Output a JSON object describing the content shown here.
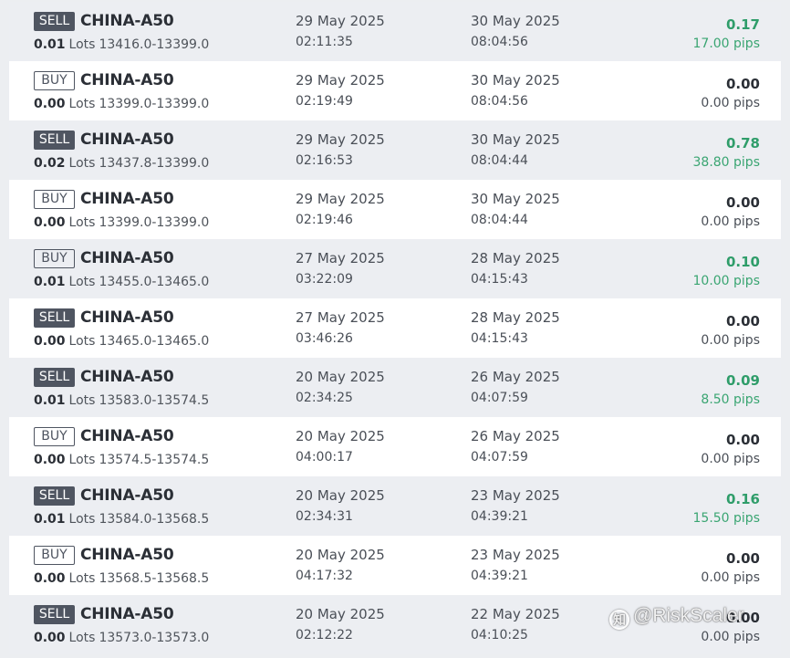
{
  "trades": [
    {
      "side": "SELL",
      "symbol": "CHINA-A50",
      "lots": "0.01",
      "lots_label": "Lots",
      "price_range": "13416.0-13399.0",
      "open_date": "29 May 2025",
      "open_time": "02:11:35",
      "close_date": "30 May 2025",
      "close_time": "08:04:56",
      "profit": "0.17",
      "pips": "17.00 pips"
    },
    {
      "side": "BUY",
      "symbol": "CHINA-A50",
      "lots": "0.00",
      "lots_label": "Lots",
      "price_range": "13399.0-13399.0",
      "open_date": "29 May 2025",
      "open_time": "02:19:49",
      "close_date": "30 May 2025",
      "close_time": "08:04:56",
      "profit": "0.00",
      "pips": "0.00 pips"
    },
    {
      "side": "SELL",
      "symbol": "CHINA-A50",
      "lots": "0.02",
      "lots_label": "Lots",
      "price_range": "13437.8-13399.0",
      "open_date": "29 May 2025",
      "open_time": "02:16:53",
      "close_date": "30 May 2025",
      "close_time": "08:04:44",
      "profit": "0.78",
      "pips": "38.80 pips"
    },
    {
      "side": "BUY",
      "symbol": "CHINA-A50",
      "lots": "0.00",
      "lots_label": "Lots",
      "price_range": "13399.0-13399.0",
      "open_date": "29 May 2025",
      "open_time": "02:19:46",
      "close_date": "30 May 2025",
      "close_time": "08:04:44",
      "profit": "0.00",
      "pips": "0.00 pips"
    },
    {
      "side": "BUY",
      "symbol": "CHINA-A50",
      "lots": "0.01",
      "lots_label": "Lots",
      "price_range": "13455.0-13465.0",
      "open_date": "27 May 2025",
      "open_time": "03:22:09",
      "close_date": "28 May 2025",
      "close_time": "04:15:43",
      "profit": "0.10",
      "pips": "10.00 pips"
    },
    {
      "side": "SELL",
      "symbol": "CHINA-A50",
      "lots": "0.00",
      "lots_label": "Lots",
      "price_range": "13465.0-13465.0",
      "open_date": "27 May 2025",
      "open_time": "03:46:26",
      "close_date": "28 May 2025",
      "close_time": "04:15:43",
      "profit": "0.00",
      "pips": "0.00 pips"
    },
    {
      "side": "SELL",
      "symbol": "CHINA-A50",
      "lots": "0.01",
      "lots_label": "Lots",
      "price_range": "13583.0-13574.5",
      "open_date": "20 May 2025",
      "open_time": "02:34:25",
      "close_date": "26 May 2025",
      "close_time": "04:07:59",
      "profit": "0.09",
      "pips": "8.50 pips"
    },
    {
      "side": "BUY",
      "symbol": "CHINA-A50",
      "lots": "0.00",
      "lots_label": "Lots",
      "price_range": "13574.5-13574.5",
      "open_date": "20 May 2025",
      "open_time": "04:00:17",
      "close_date": "26 May 2025",
      "close_time": "04:07:59",
      "profit": "0.00",
      "pips": "0.00 pips"
    },
    {
      "side": "SELL",
      "symbol": "CHINA-A50",
      "lots": "0.01",
      "lots_label": "Lots",
      "price_range": "13584.0-13568.5",
      "open_date": "20 May 2025",
      "open_time": "02:34:31",
      "close_date": "23 May 2025",
      "close_time": "04:39:21",
      "profit": "0.16",
      "pips": "15.50 pips"
    },
    {
      "side": "BUY",
      "symbol": "CHINA-A50",
      "lots": "0.00",
      "lots_label": "Lots",
      "price_range": "13568.5-13568.5",
      "open_date": "20 May 2025",
      "open_time": "04:17:32",
      "close_date": "23 May 2025",
      "close_time": "04:39:21",
      "profit": "0.00",
      "pips": "0.00 pips"
    },
    {
      "side": "SELL",
      "symbol": "CHINA-A50",
      "lots": "0.00",
      "lots_label": "Lots",
      "price_range": "13573.0-13573.0",
      "open_date": "20 May 2025",
      "open_time": "02:12:22",
      "close_date": "22 May 2025",
      "close_time": "04:10:25",
      "profit": "0.00",
      "pips": "0.00 pips"
    }
  ],
  "watermark": {
    "text": "@RiskScaler",
    "icon": "zhihu-logo-icon"
  },
  "colors": {
    "profit_positive": "#2f9d6a",
    "sell_badge": "#4f5561",
    "row_alt": "#eceef2"
  }
}
